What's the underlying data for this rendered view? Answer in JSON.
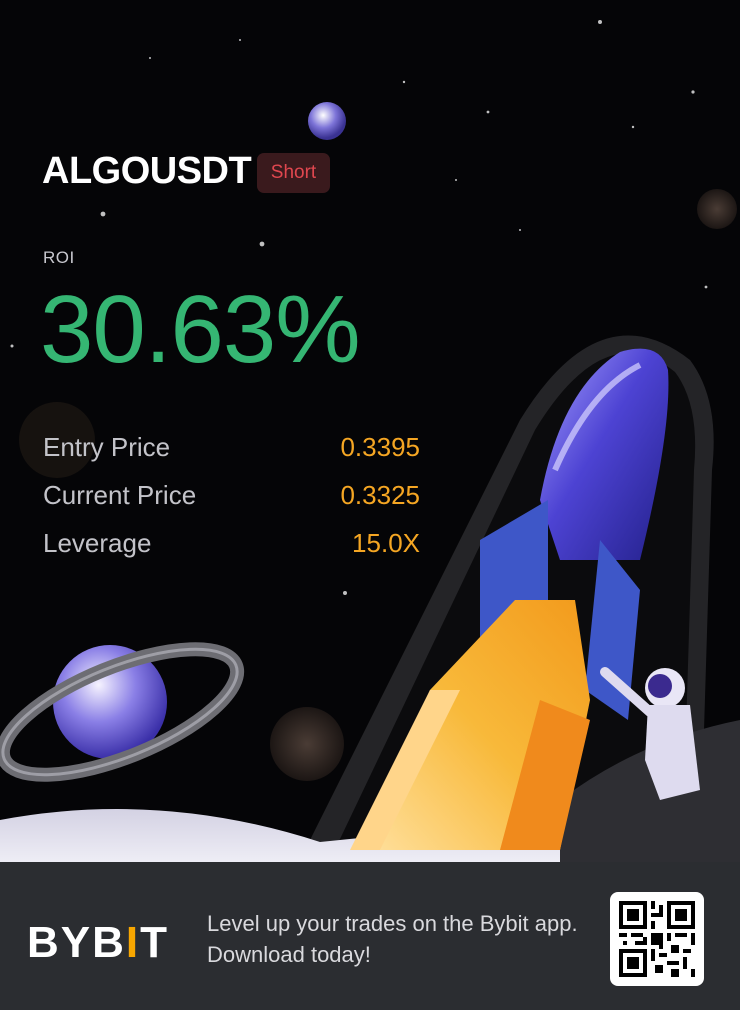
{
  "trade": {
    "pair": "ALGOUSDT",
    "side": "Short",
    "roi_label": "ROI",
    "roi_value": "30.63%"
  },
  "stats": [
    {
      "label": "Entry Price",
      "value": "0.3395"
    },
    {
      "label": "Current Price",
      "value": "0.3325"
    },
    {
      "label": "Leverage",
      "value": "15.0X"
    }
  ],
  "footer": {
    "logo_prefix": "BYB",
    "logo_i": "I",
    "logo_suffix": "T",
    "tagline": "Level up your trades on the Bybit app. Download today!"
  },
  "colors": {
    "positive": "#35b673",
    "short_badge": "#e0474f",
    "value_accent": "#f5a623",
    "brand_accent": "#f7a600",
    "footer_bg": "#2b2d31"
  },
  "icons": [
    "rocket-illustration",
    "planet-illustration",
    "astronaut-illustration",
    "qr-code-icon"
  ]
}
